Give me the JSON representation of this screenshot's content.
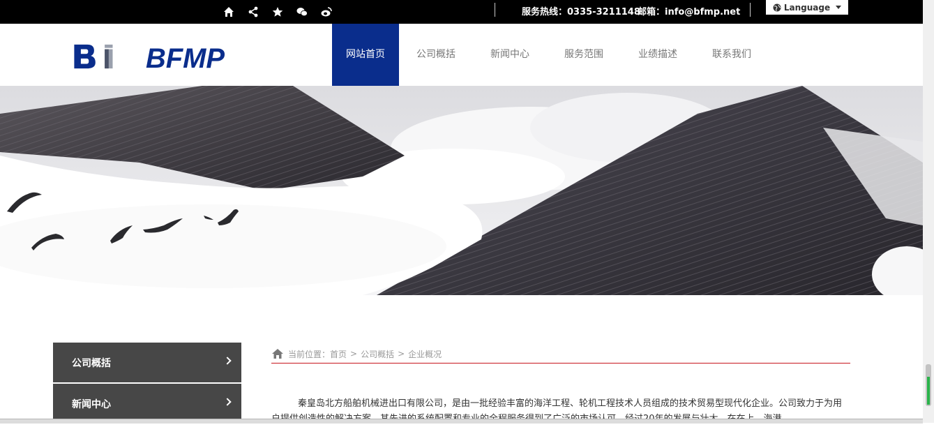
{
  "topbar": {
    "icons": [
      "home-icon",
      "share-icon",
      "star-icon",
      "wechat-icon",
      "weibo-icon"
    ],
    "hotline": "服务热线：0335-3211148",
    "email": "邮箱：info@bfmp.net",
    "language": "Language"
  },
  "brand": {
    "logo_text": "BFMP",
    "color": "#0a2d8c"
  },
  "nav": {
    "items": [
      "网站首页",
      "公司概括",
      "新闻中心",
      "服务范围",
      "业绩描述",
      "联系我们"
    ],
    "active_index": 0,
    "active_color": "#0a2d8c"
  },
  "sidebar": {
    "items": [
      "公司概括",
      "新闻中心"
    ]
  },
  "breadcrumb": {
    "prefix": "当前位置：",
    "links": [
      "首页",
      "公司概括",
      "企业概况"
    ],
    "separator": ">",
    "underline_color": "#c8161d"
  },
  "content": {
    "paragraph": "秦皇岛北方船舶机械进出口有限公司，是由一批经验丰富的海洋工程、轮机工程技术人员组成的技术贸易型现代化企业。公司致力于为用户提供创造性的解决方案，其先进的系统配置和专业的全程服务得到了广泛的市场认可，经过20年的发展与壮大，在在上、海港"
  }
}
